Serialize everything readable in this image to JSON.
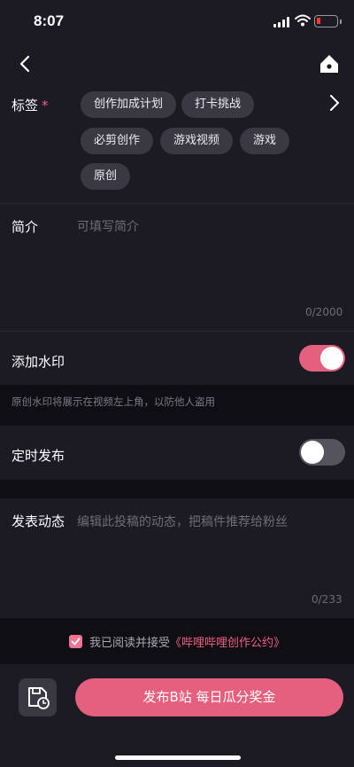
{
  "status_bar": {
    "time": "8:07",
    "battery_color": "#ff3b30"
  },
  "nav": {
    "back_icon": "chevron-left-icon",
    "home_icon": "home-icon"
  },
  "tags": {
    "label": "标签",
    "required_mark": "*",
    "chips": [
      "创作加成计划",
      "打卡挑战",
      "必剪创作",
      "游戏视频",
      "游戏",
      "原创"
    ]
  },
  "intro": {
    "label": "简介",
    "placeholder": "可填写简介",
    "counter": "0/2000"
  },
  "watermark": {
    "label": "添加水印",
    "enabled": true,
    "hint": "原创水印将展示在视频左上角，以防他人盗用"
  },
  "schedule": {
    "label": "定时发布",
    "enabled": false
  },
  "dynamic": {
    "label": "发表动态",
    "placeholder": "编辑此投稿的动态，把稿件推荐给粉丝",
    "counter": "0/233"
  },
  "agreement": {
    "checked": true,
    "text": "我已阅读并接受",
    "link": "《哔哩哔哩创作公约》"
  },
  "footer": {
    "publish_label": "发布B站 每日瓜分奖金",
    "draft_icon": "save-draft-icon"
  },
  "colors": {
    "accent": "#e5607f",
    "background": "#1c1a23",
    "chip": "#3a3842"
  }
}
